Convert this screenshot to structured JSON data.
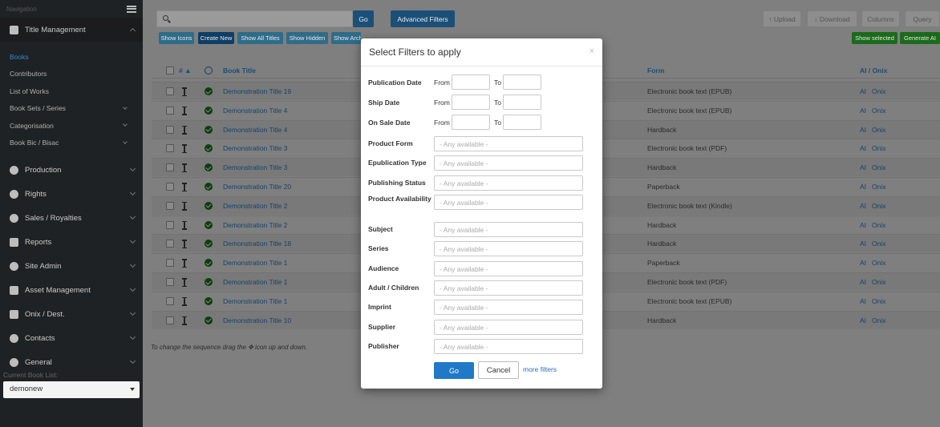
{
  "sidebar": {
    "nav_label": "Navigation",
    "sections": [
      {
        "label": "Title Management",
        "icon": "book-icon"
      },
      {
        "label": "Production",
        "icon": "palette-icon"
      },
      {
        "label": "Rights",
        "icon": "key-icon"
      },
      {
        "label": "Sales / Royalties",
        "icon": "pie-chart-icon"
      },
      {
        "label": "Reports",
        "icon": "file-icon"
      },
      {
        "label": "Site Admin",
        "icon": "cloud-icon"
      },
      {
        "label": "Asset Management",
        "icon": "image-icon"
      },
      {
        "label": "Onix / Dest.",
        "icon": "exchange-icon"
      },
      {
        "label": "Contacts",
        "icon": "users-icon"
      },
      {
        "label": "General",
        "icon": "cogs-icon"
      }
    ],
    "sub_items": [
      "Books",
      "Contributors",
      "List of Works",
      "Book Sets / Series",
      "Categorisation",
      "Book Bic / Bisac"
    ],
    "book_list_label": "Current Book List:",
    "book_list_value": "demonew"
  },
  "toolbar": {
    "go": "Go",
    "advanced_filters": "Advanced Filters",
    "upload": "↑ Upload",
    "download": "↓ Download",
    "columns": "Columns",
    "query": "Query",
    "show_icons": "Show Icons",
    "create_new": "Create New",
    "show_all_titles": "Show All Titles",
    "show_hidden": "Show Hidden",
    "show_archived": "Show Archived",
    "show_selected": "Show selected",
    "generate_ai": "Generate AI"
  },
  "table": {
    "headers": {
      "num": "# ▲",
      "book_title": "Book Title",
      "form": "Form",
      "ai_onix": "AI / Onix"
    },
    "ai_label": "AI",
    "onix_label": "Onix",
    "rows": [
      {
        "title": "Demonstration Title 19",
        "form": "Electronic book text (EPUB)"
      },
      {
        "title": "Demonstration Title 4",
        "form": "Electronic book text (EPUB)"
      },
      {
        "title": "Demonstration Title 4",
        "form": "Hardback"
      },
      {
        "title": "Demonstration Title 3",
        "form": "Electronic book text (PDF)"
      },
      {
        "title": "Demonstration Title 3",
        "form": "Hardback"
      },
      {
        "title": "Demonstration Title 20",
        "form": "Paperback"
      },
      {
        "title": "Demonstration Title 2",
        "form": "Electronic book text (Kindle)"
      },
      {
        "title": "Demonstration Title 2",
        "form": "Hardback"
      },
      {
        "title": "Demonstration Title 18",
        "form": "Hardback"
      },
      {
        "title": "Demonstration Title 1",
        "form": "Paperback"
      },
      {
        "title": "Demonstration Title 1",
        "form": "Electronic book text (PDF)"
      },
      {
        "title": "Demonstration Title 1",
        "form": "Electronic book text (EPUB)"
      },
      {
        "title": "Demonstration Title 10",
        "form": "Hardback"
      }
    ],
    "footnote": "To change the sequence drag the ✥ icon up and down."
  },
  "modal": {
    "title": "Select Filters to apply",
    "close": "×",
    "from": "From",
    "to": "To",
    "date_filters": [
      "Publication Date",
      "Ship Date",
      "On Sale Date"
    ],
    "select_filters": [
      "Product Form",
      "Epublication Type",
      "Publishing Status",
      "Product Availability",
      "Subject",
      "Series",
      "Audience",
      "Adult / Children",
      "Imprint",
      "Supplier",
      "Publisher"
    ],
    "placeholder": "- Any available -",
    "go": "Go",
    "cancel": "Cancel",
    "more_filters": "more filters"
  }
}
